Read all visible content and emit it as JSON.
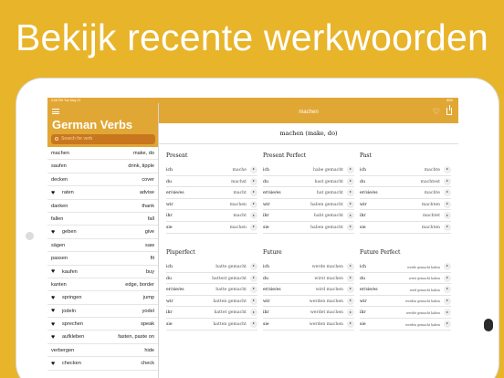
{
  "headline": "Bekijk recente werkwoorden",
  "status": {
    "time": "9:08 PM",
    "date": "Tue May 21",
    "battery": "89%"
  },
  "sidebar": {
    "title": "German Verbs",
    "search_placeholder": "Search for verb",
    "items": [
      {
        "verb": "machen",
        "translation": "make, do",
        "favorite": false
      },
      {
        "verb": "saufen",
        "translation": "drink, tipple",
        "favorite": false
      },
      {
        "verb": "decken",
        "translation": "cover",
        "favorite": false
      },
      {
        "verb": "raten",
        "translation": "advise",
        "favorite": true
      },
      {
        "verb": "danken",
        "translation": "thank",
        "favorite": false
      },
      {
        "verb": "fallen",
        "translation": "fall",
        "favorite": false
      },
      {
        "verb": "geben",
        "translation": "give",
        "favorite": true
      },
      {
        "verb": "sägen",
        "translation": "saw",
        "favorite": false
      },
      {
        "verb": "passen",
        "translation": "fit",
        "favorite": false
      },
      {
        "verb": "kaufen",
        "translation": "buy",
        "favorite": true
      },
      {
        "verb": "kanten",
        "translation": "edge, border",
        "favorite": false
      },
      {
        "verb": "springen",
        "translation": "jump",
        "favorite": true
      },
      {
        "verb": "jodeln",
        "translation": "yodel",
        "favorite": true
      },
      {
        "verb": "sprechen",
        "translation": "speak",
        "favorite": true
      },
      {
        "verb": "aufkleben",
        "translation": "fasten, paste on",
        "favorite": true
      },
      {
        "verb": "verbergen",
        "translation": "hide",
        "favorite": false
      },
      {
        "verb": "checken",
        "translation": "check",
        "favorite": true
      }
    ]
  },
  "main": {
    "nav_title": "machen",
    "verb_title": "machen (make, do)",
    "tenses": [
      {
        "name": "Present",
        "rows": [
          {
            "pronoun": "ich",
            "form": "mache"
          },
          {
            "pronoun": "du",
            "form": "machst"
          },
          {
            "pronoun": "er/sie/es",
            "form": "macht"
          },
          {
            "pronoun": "wir",
            "form": "machen"
          },
          {
            "pronoun": "ihr",
            "form": "macht"
          },
          {
            "pronoun": "sie",
            "form": "machen"
          }
        ]
      },
      {
        "name": "Present Perfect",
        "rows": [
          {
            "pronoun": "ich",
            "form": "habe gemacht"
          },
          {
            "pronoun": "du",
            "form": "hast gemacht"
          },
          {
            "pronoun": "er/sie/es",
            "form": "hat gemacht"
          },
          {
            "pronoun": "wir",
            "form": "haben gemacht"
          },
          {
            "pronoun": "ihr",
            "form": "habt gemacht"
          },
          {
            "pronoun": "sie",
            "form": "haben gemacht"
          }
        ]
      },
      {
        "name": "Past",
        "rows": [
          {
            "pronoun": "ich",
            "form": "machte"
          },
          {
            "pronoun": "du",
            "form": "machtest"
          },
          {
            "pronoun": "er/sie/es",
            "form": "machte"
          },
          {
            "pronoun": "wir",
            "form": "machten"
          },
          {
            "pronoun": "ihr",
            "form": "machtet"
          },
          {
            "pronoun": "sie",
            "form": "machten"
          }
        ]
      },
      {
        "name": "Pluperfect",
        "rows": [
          {
            "pronoun": "ich",
            "form": "hatte gemacht"
          },
          {
            "pronoun": "du",
            "form": "hattest gemacht"
          },
          {
            "pronoun": "er/sie/es",
            "form": "hatte gemacht"
          },
          {
            "pronoun": "wir",
            "form": "hatten gemacht"
          },
          {
            "pronoun": "ihr",
            "form": "hattet gemacht"
          },
          {
            "pronoun": "sie",
            "form": "hatten gemacht"
          }
        ]
      },
      {
        "name": "Future",
        "rows": [
          {
            "pronoun": "ich",
            "form": "werde machen"
          },
          {
            "pronoun": "du",
            "form": "wirst machen"
          },
          {
            "pronoun": "er/sie/es",
            "form": "wird machen"
          },
          {
            "pronoun": "wir",
            "form": "werden machen"
          },
          {
            "pronoun": "ihr",
            "form": "werdet machen"
          },
          {
            "pronoun": "sie",
            "form": "werden machen"
          }
        ]
      },
      {
        "name": "Future Perfect",
        "rows": [
          {
            "pronoun": "ich",
            "form": "werde gemacht haben"
          },
          {
            "pronoun": "du",
            "form": "wirst gemacht haben"
          },
          {
            "pronoun": "er/sie/es",
            "form": "wird gemacht haben"
          },
          {
            "pronoun": "wir",
            "form": "werden gemacht haben"
          },
          {
            "pronoun": "ihr",
            "form": "werdet gemacht haben"
          },
          {
            "pronoun": "sie",
            "form": "werden gemacht haben"
          }
        ]
      }
    ]
  }
}
